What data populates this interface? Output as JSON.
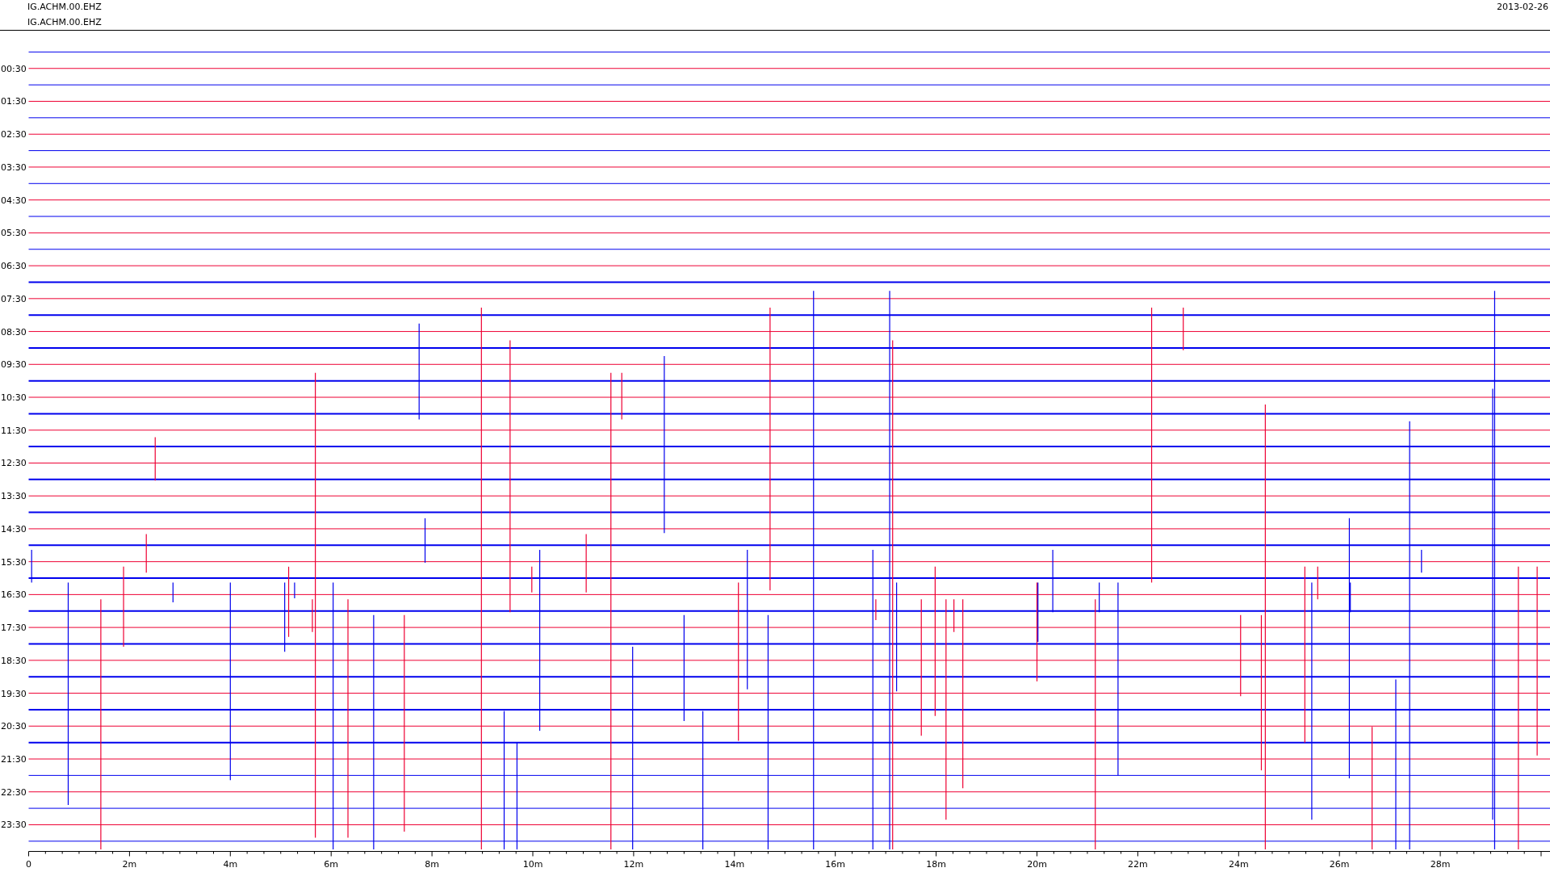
{
  "header": {
    "titles": [
      "IG.ACHM.00.EHZ",
      "IG.ACHM.00.EHZ"
    ],
    "date": "2013-02-26"
  },
  "chart": {
    "hour_labels": [
      "00:30",
      "01:30",
      "02:30",
      "03:30",
      "04:30",
      "05:30",
      "06:30",
      "07:30",
      "08:30",
      "09:30",
      "10:30",
      "11:30",
      "12:30",
      "13:30",
      "14:30",
      "15:30",
      "16:30",
      "17:30",
      "18:30",
      "19:30",
      "20:30",
      "21:30",
      "22:30",
      "23:30"
    ],
    "minute_labels": [
      "0",
      "2m",
      "4m",
      "6m",
      "8m",
      "10m",
      "12m",
      "14m",
      "16m",
      "18m",
      "20m",
      "22m",
      "24m",
      "26m",
      "28m"
    ]
  }
}
